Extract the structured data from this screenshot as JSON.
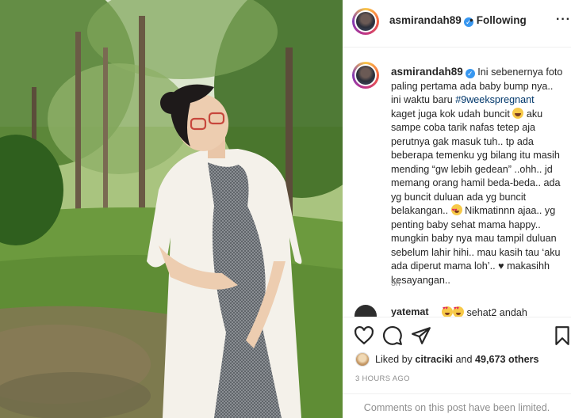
{
  "post": {
    "username": "asmirandah89",
    "verified_icon": "verified-badge-icon",
    "follow_separator": "•",
    "follow_status": "Following",
    "more_label": "···"
  },
  "caption": {
    "username": "asmirandah89",
    "part1": " Ini sebenernya foto paling pertama ada baby bump nya.. ini waktu baru ",
    "hashtag": "#9weekspregnant",
    "part2": " kaget juga kok udah buncit ",
    "emoji1": "grinning-face-with-sweat-emoji",
    "part3": " aku sampe coba tarik nafas tetep aja perutnya gak masuk tuh.. tp ada beberapa temenku yg bilang itu masih mending “gw lebih gedean” ..ohh.. jd memang orang hamil beda-beda.. ada yg buncit duluan ada yg buncit belakangan.. ",
    "emoji2": "smiling-face-with-heart-eyes-emoji",
    "part4": " Nikmatinnn ajaa.. yg penting baby sehat mama happy.. mungkin baby nya mau tampil duluan sebelum lahir hihi.. mau kasih tau ‘aku ada diperut mama loh’.. ♥ makasihh kesayangan..",
    "time": "3h"
  },
  "comment": {
    "username": "yatemat",
    "text": " sehat2 andah"
  },
  "actions": {
    "like_icon": "heart-icon",
    "comment_icon": "comment-icon",
    "share_icon": "send-icon",
    "save_icon": "bookmark-icon"
  },
  "likes": {
    "prefix": "Liked by ",
    "liker": "citraciki",
    "middle": " and ",
    "count": "49,673 others"
  },
  "post_time": "3 HOURS AGO",
  "comments_notice": "Comments on this post have been limited."
}
